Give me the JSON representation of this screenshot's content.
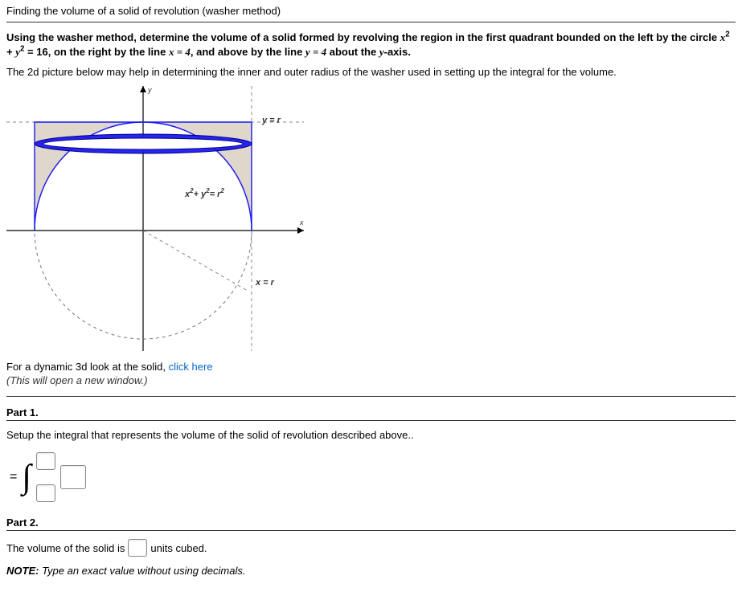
{
  "title": "Finding the volume of a solid of revolution (washer method)",
  "problem": {
    "lead_a": "Using the washer method, determine the volume of a solid formed by revolving the region in the first quadrant bounded on the left by the circle ",
    "eq_circle_lhs_x": "x",
    "eq_circle_exp": "2",
    "eq_circle_plus": " + ",
    "eq_circle_lhs_y": "y",
    "eq_circle_exp2": "2",
    "eq_circle_rhs": " = 16",
    "lead_b": ", on the right by the line ",
    "eq_line_x": "x = 4",
    "lead_c": ", and above by the line ",
    "eq_line_y": "y = 4",
    "lead_d": " about the ",
    "axis_var": "y",
    "axis_word": "-axis."
  },
  "hint": "The 2d picture below may help in determining the inner and outer radius of the washer used in setting up the integral for the volume.",
  "figure": {
    "label_circle1": "x",
    "label_circle2": "2",
    "label_circle3": "+ y",
    "label_circle4": "2",
    "label_circle5": "= r",
    "label_circle6": "2",
    "label_top": "y = r",
    "label_side": "x = r",
    "axis_x": "x",
    "axis_y": "y"
  },
  "dynamic_link": {
    "prefix": "For a dynamic 3d look at the solid, ",
    "link_text": "click here",
    "caption": "(This will open a new window.)"
  },
  "part1": {
    "heading": "Part 1.",
    "instruction": "Setup the integral that represents the volume of the solid of revolution described above.."
  },
  "part2": {
    "heading": "Part 2.",
    "lead": "The volume of the solid is ",
    "trail": " units cubed.",
    "note_label": "NOTE:",
    "note_body": " Type an exact value without using decimals."
  }
}
